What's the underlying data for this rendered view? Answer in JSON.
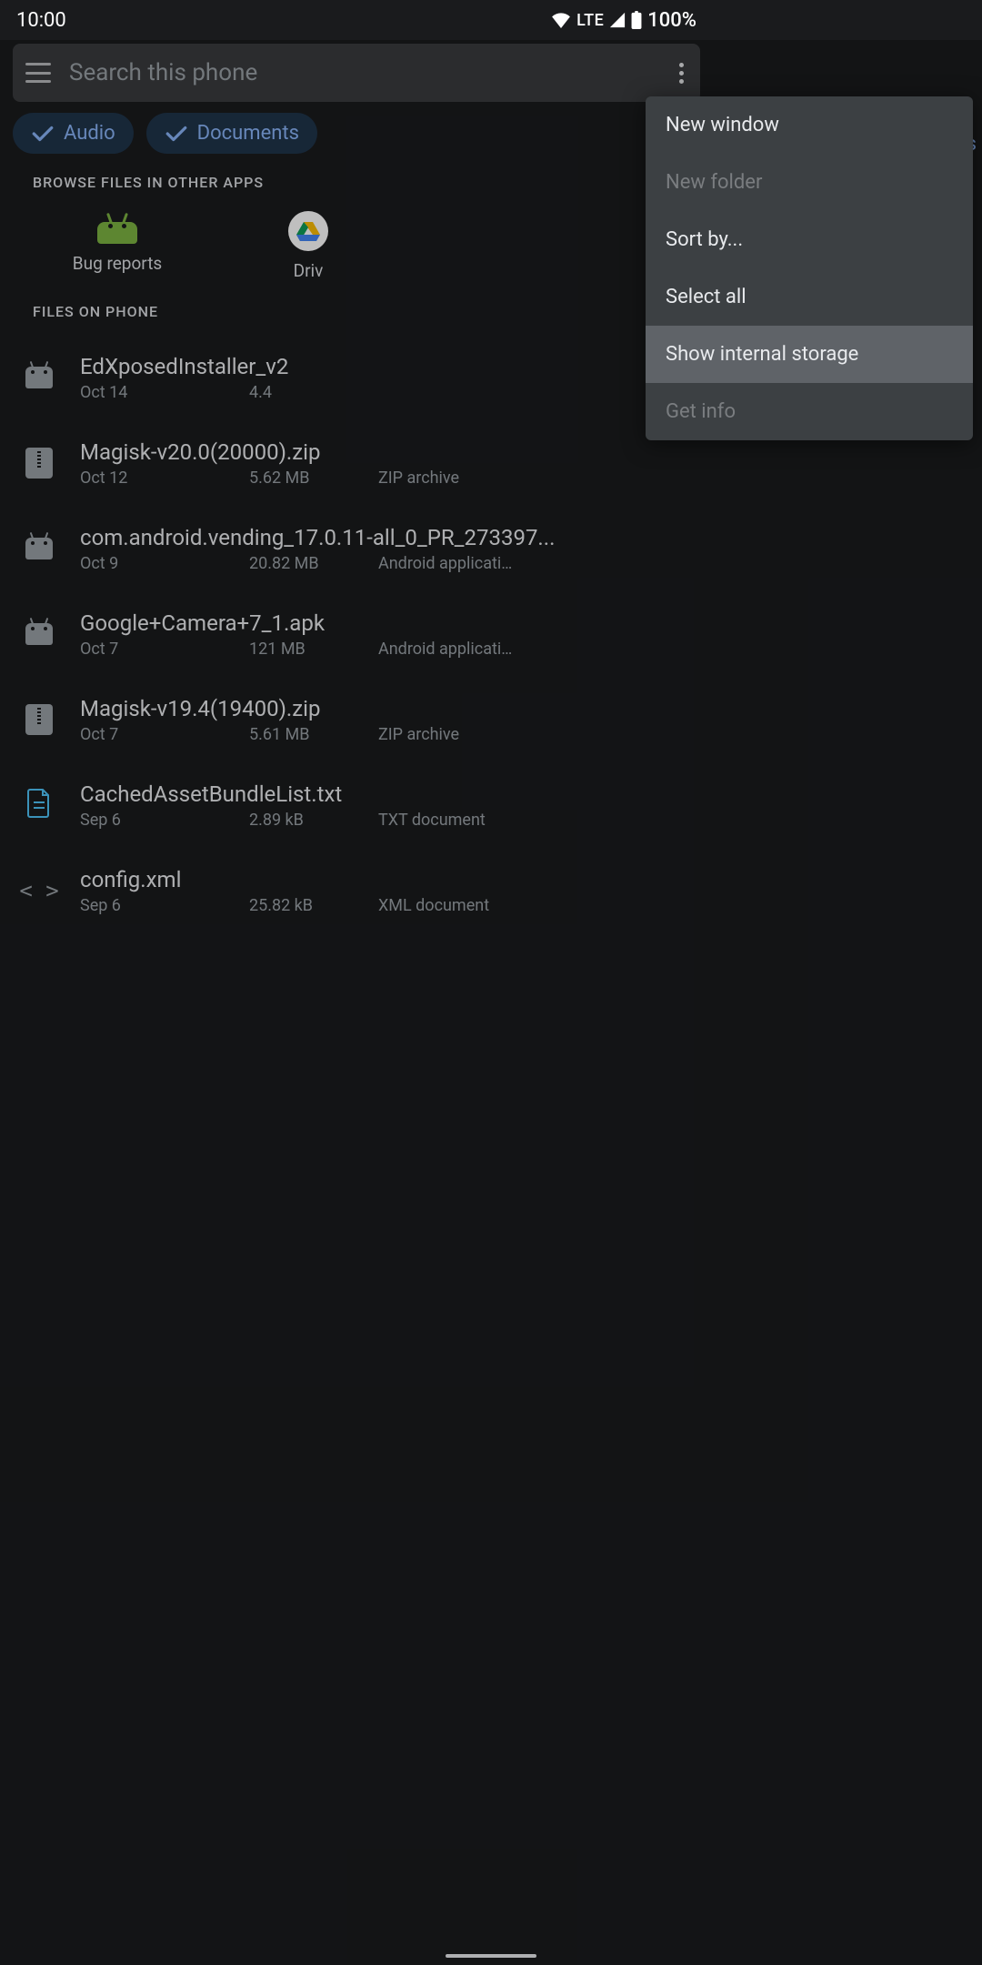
{
  "status": {
    "time": "10:00",
    "lte": "LTE",
    "battery": "100%"
  },
  "search": {
    "placeholder": "Search this phone"
  },
  "chips": {
    "audio": "Audio",
    "docs": "Documents",
    "trail": "os"
  },
  "browse": {
    "title": "BROWSE FILES IN OTHER APPS",
    "bug": "Bug reports",
    "drive": "Driv"
  },
  "filesTitle": "FILES ON PHONE",
  "rows": [
    {
      "name": "EdXposedInstaller_v2",
      "date": "Oct 14",
      "size": "4.4",
      "type": "",
      "icon": "android"
    },
    {
      "name": "Magisk-v20.0(20000).zip",
      "date": "Oct 12",
      "size": "5.62 MB",
      "type": "ZIP archive",
      "icon": "zip"
    },
    {
      "name": "com.android.vending_17.0.11-all_0_PR_273397...",
      "date": "Oct 9",
      "size": "20.82 MB",
      "type": "Android applicati…",
      "icon": "android"
    },
    {
      "name": "Google+Camera+7_1.apk",
      "date": "Oct 7",
      "size": "121 MB",
      "type": "Android applicati…",
      "icon": "android"
    },
    {
      "name": "Magisk-v19.4(19400).zip",
      "date": "Oct 7",
      "size": "5.61 MB",
      "type": "ZIP archive",
      "icon": "zip"
    },
    {
      "name": "CachedAssetBundleList.txt",
      "date": "Sep 6",
      "size": "2.89 kB",
      "type": "TXT document",
      "icon": "txt"
    },
    {
      "name": "config.xml",
      "date": "Sep 6",
      "size": "25.82 kB",
      "type": "XML document",
      "icon": "xml"
    }
  ],
  "menu": {
    "newWindow": "New window",
    "newFolder": "New folder",
    "sortBy": "Sort by...",
    "selectAll": "Select all",
    "showInternal": "Show internal storage",
    "getInfo": "Get info"
  }
}
